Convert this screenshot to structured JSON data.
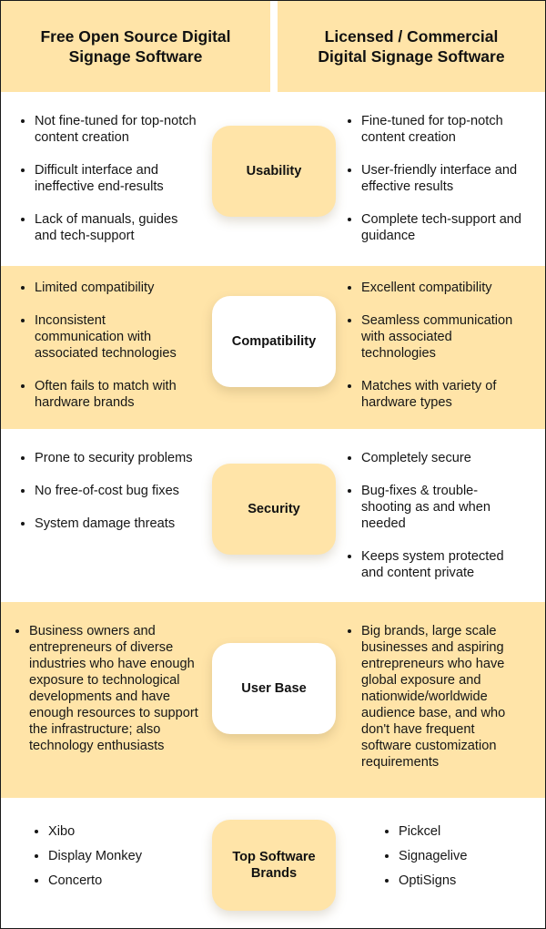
{
  "header": {
    "left_title": "Free Open Source Digital Signage Software",
    "left_lines": [
      "Free Open Source Digital",
      "Signage Software"
    ],
    "right_title": "Licensed / Commercial Digital Signage Software",
    "right_lines": [
      "Licensed / Commercial",
      "Digital Signage Software"
    ]
  },
  "colors": {
    "accent_yellow": "#ffe4a8",
    "white": "#ffffff",
    "text": "#111111"
  },
  "rows": [
    {
      "category": "Usability",
      "open_source": [
        "Not fine-tuned for top-notch content creation",
        "Difficult interface and ineffective end-results",
        "Lack of manuals, guides and tech-support"
      ],
      "commercial": [
        "Fine-tuned for top-notch content creation",
        "User-friendly interface and effective results",
        "Complete tech-support and guidance"
      ]
    },
    {
      "category": "Compatibility",
      "open_source": [
        "Limited compatibility",
        "Inconsistent communication with associated technologies",
        "Often fails to match with hardware brands"
      ],
      "commercial": [
        "Excellent compatibility",
        "Seamless communication with associated technologies",
        "Matches with variety of hardware types"
      ]
    },
    {
      "category": "Security",
      "open_source": [
        "Prone to security problems",
        "No free-of-cost bug fixes",
        "System damage threats"
      ],
      "commercial": [
        "Completely secure",
        "Bug-fixes & trouble-shooting as and when needed",
        "Keeps system protected and content private"
      ]
    },
    {
      "category": "User Base",
      "open_source": [
        "Business owners and entrepreneurs of diverse industries who have enough exposure to technological developments and have enough resources to support the infrastructure; also technology enthusiasts"
      ],
      "commercial": [
        "Big brands, large scale businesses and aspiring entrepreneurs who have global exposure and nationwide/worldwide audience base, and who don't have frequent software customization requirements"
      ]
    },
    {
      "category": "Top Software Brands",
      "open_source": [
        "Xibo",
        "Display Monkey",
        "Concerto"
      ],
      "commercial": [
        "Pickcel",
        "Signagelive",
        "OptiSigns"
      ]
    }
  ]
}
